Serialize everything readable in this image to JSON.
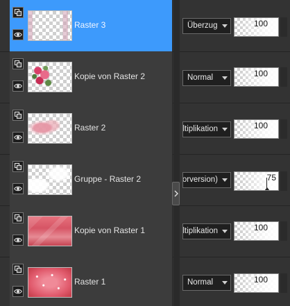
{
  "layers": [
    {
      "name": "Raster 3",
      "blend_mode": "Überzug",
      "opacity": 100,
      "selected": true,
      "visible": true
    },
    {
      "name": "Kopie von Raster 2",
      "blend_mode": "Normal",
      "opacity": 100,
      "selected": false,
      "visible": true
    },
    {
      "name": "Raster 2",
      "blend_mode": "Multiplikation",
      "opacity": 100,
      "selected": false,
      "visible": true
    },
    {
      "name": "Gruppe - Raster 2",
      "blend_mode": "Luminanz (Vorversion)",
      "opacity": 75,
      "selected": false,
      "visible": true
    },
    {
      "name": "Kopie von Raster 1",
      "blend_mode": "Multiplikation",
      "opacity": 100,
      "selected": false,
      "visible": true
    },
    {
      "name": "Raster 1",
      "blend_mode": "Normal",
      "opacity": 100,
      "selected": false,
      "visible": true
    }
  ],
  "colors": {
    "selection": "#3d9afc",
    "panel": "#3c3c3c",
    "background": "#333333"
  },
  "icons": {
    "layer_type": "raster-layer-icon",
    "visibility": "eye-icon",
    "splitter": "chevron-right-icon",
    "dropdown": "chevron-down-icon"
  }
}
